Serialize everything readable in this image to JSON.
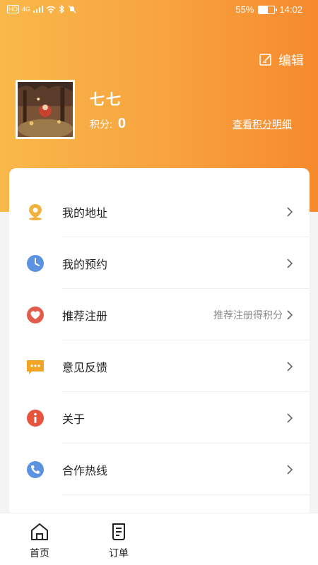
{
  "status_bar": {
    "left_icons": [
      "HD",
      "4G",
      "signal-icon",
      "wifi-icon",
      "bluetooth-icon",
      "mute-icon"
    ],
    "battery_text": "55%",
    "battery_level": 0.55,
    "time": "14:02"
  },
  "header": {
    "edit_label": "编辑",
    "user_name": "七七",
    "points_label": "积分:",
    "points_value": "0",
    "points_detail_link": "查看积分明细",
    "gradient_colors": [
      "#f9b84a",
      "#f68a2e"
    ]
  },
  "menu": {
    "items": [
      {
        "label": "我的地址",
        "icon": "location-pin-icon",
        "hint": ""
      },
      {
        "label": "我的预约",
        "icon": "clock-icon",
        "hint": ""
      },
      {
        "label": "推荐注册",
        "icon": "heart-icon",
        "hint": "推荐注册得积分"
      },
      {
        "label": "意见反馈",
        "icon": "message-icon",
        "hint": ""
      },
      {
        "label": "关于",
        "icon": "info-icon",
        "hint": ""
      },
      {
        "label": "合作热线",
        "icon": "phone-icon",
        "hint": ""
      }
    ]
  },
  "tabbar": {
    "tabs": [
      {
        "label": "首页",
        "icon": "home-icon"
      },
      {
        "label": "订单",
        "icon": "order-icon"
      }
    ]
  }
}
